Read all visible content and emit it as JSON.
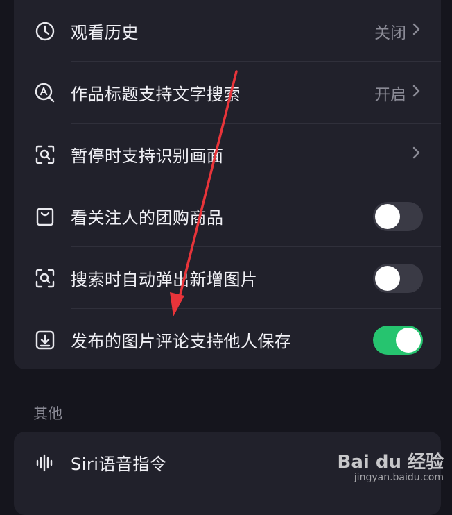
{
  "settings": {
    "items": [
      {
        "label": "观看历史",
        "value": "关闭",
        "icon": "clock-icon"
      },
      {
        "label": "作品标题支持文字搜索",
        "value": "开启",
        "icon": "search-a-icon"
      },
      {
        "label": "暂停时支持识别画面",
        "value": "",
        "icon": "scan-icon"
      },
      {
        "label": "看关注人的团购商品",
        "toggle": "off",
        "icon": "bag-icon"
      },
      {
        "label": "搜索时自动弹出新增图片",
        "toggle": "off",
        "icon": "scan-icon"
      },
      {
        "label": "发布的图片评论支持他人保存",
        "toggle": "on",
        "icon": "download-icon"
      }
    ]
  },
  "other": {
    "section_title": "其他",
    "items": [
      {
        "label": "Siri语音指令",
        "icon": "sound-wave-icon"
      }
    ]
  },
  "watermark": {
    "brand": "Bai du 经验",
    "url": "jingyan.baidu.com"
  },
  "colors": {
    "background": "#15151d",
    "card": "#21212b",
    "toggle_on": "#26c46f",
    "annotation_arrow": "#e8343a"
  }
}
